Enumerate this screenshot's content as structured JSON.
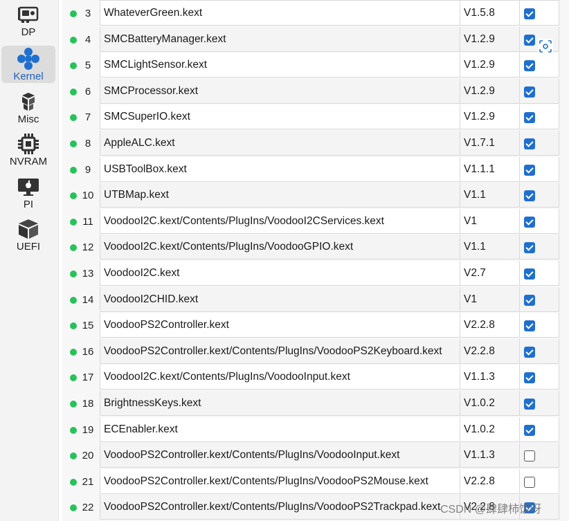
{
  "sidebar": {
    "items": [
      {
        "label": "DP",
        "icon": "graphics-card-icon",
        "active": false
      },
      {
        "label": "Kernel",
        "icon": "kernel-nodes-icon",
        "active": true
      },
      {
        "label": "Misc",
        "icon": "cubes-icon",
        "active": false
      },
      {
        "label": "NVRAM",
        "icon": "chip-icon",
        "active": false
      },
      {
        "label": "PI",
        "icon": "monitor-apple-icon",
        "active": false
      },
      {
        "label": "UEFI",
        "icon": "box-icon",
        "active": false
      }
    ]
  },
  "colors": {
    "accent": "#1f6fcf",
    "status_green": "#27c25a",
    "active_label": "#1f5fbf"
  },
  "kext_table": {
    "rows": [
      {
        "index": "3",
        "name": "WhateverGreen.kext",
        "version": "V1.5.8",
        "enabled": true
      },
      {
        "index": "4",
        "name": "SMCBatteryManager.kext",
        "version": "V1.2.9",
        "enabled": true
      },
      {
        "index": "5",
        "name": "SMCLightSensor.kext",
        "version": "V1.2.9",
        "enabled": true
      },
      {
        "index": "6",
        "name": "SMCProcessor.kext",
        "version": "V1.2.9",
        "enabled": true
      },
      {
        "index": "7",
        "name": "SMCSuperIO.kext",
        "version": "V1.2.9",
        "enabled": true
      },
      {
        "index": "8",
        "name": "AppleALC.kext",
        "version": "V1.7.1",
        "enabled": true
      },
      {
        "index": "9",
        "name": "USBToolBox.kext",
        "version": "V1.1.1",
        "enabled": true
      },
      {
        "index": "10",
        "name": "UTBMap.kext",
        "version": "V1.1",
        "enabled": true
      },
      {
        "index": "11",
        "name": "VoodooI2C.kext/Contents/PlugIns/VoodooI2CServices.kext",
        "version": "V1",
        "enabled": true
      },
      {
        "index": "12",
        "name": "VoodooI2C.kext/Contents/PlugIns/VoodooGPIO.kext",
        "version": "V1.1",
        "enabled": true
      },
      {
        "index": "13",
        "name": "VoodooI2C.kext",
        "version": "V2.7",
        "enabled": true
      },
      {
        "index": "14",
        "name": "VoodooI2CHID.kext",
        "version": "V1",
        "enabled": true
      },
      {
        "index": "15",
        "name": "VoodooPS2Controller.kext",
        "version": "V2.2.8",
        "enabled": true
      },
      {
        "index": "16",
        "name": "VoodooPS2Controller.kext/Contents/PlugIns/VoodooPS2Keyboard.kext",
        "version": "V2.2.8",
        "enabled": true
      },
      {
        "index": "17",
        "name": "VoodooI2C.kext/Contents/PlugIns/VoodooInput.kext",
        "version": "V1.1.3",
        "enabled": true
      },
      {
        "index": "18",
        "name": "BrightnessKeys.kext",
        "version": "V1.0.2",
        "enabled": true
      },
      {
        "index": "19",
        "name": "ECEnabler.kext",
        "version": "V1.0.2",
        "enabled": true
      },
      {
        "index": "20",
        "name": "VoodooPS2Controller.kext/Contents/PlugIns/VoodooInput.kext",
        "version": "V1.1.3",
        "enabled": false
      },
      {
        "index": "21",
        "name": "VoodooPS2Controller.kext/Contents/PlugIns/VoodooPS2Mouse.kext",
        "version": "V2.2.8",
        "enabled": false
      },
      {
        "index": "22",
        "name": "VoodooPS2Controller.kext/Contents/PlugIns/VoodooPS2Trackpad.kext",
        "version": "V2.2.8",
        "enabled": true
      }
    ]
  },
  "floating_tool": {
    "icon": "screenshot-scan-icon"
  },
  "watermark": {
    "text": "CSDN @肆肆柿饭呀"
  }
}
